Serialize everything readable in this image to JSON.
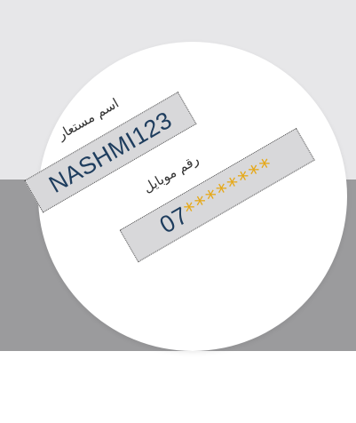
{
  "username_field": {
    "label": "اسم مستعار",
    "value": "NASHMI123"
  },
  "mobile_field": {
    "label": "رقم موبايل",
    "prefix": "07",
    "masked": "********"
  }
}
